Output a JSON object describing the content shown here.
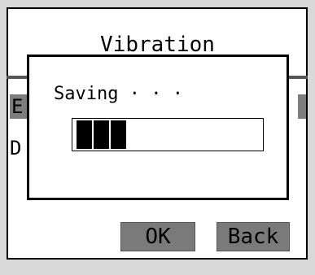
{
  "screen": {
    "title": "Vibration",
    "hidden_item_letter": "E",
    "hidden_row_letter": "D"
  },
  "dialog": {
    "message": "Saving · · ·",
    "progress": {
      "segments_filled": 3
    }
  },
  "buttons": {
    "ok": "OK",
    "back": "Back"
  }
}
